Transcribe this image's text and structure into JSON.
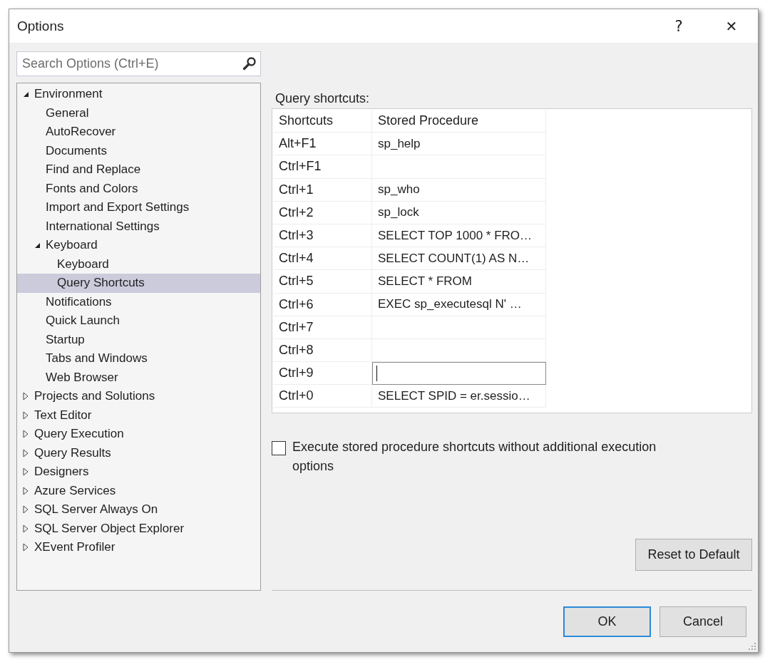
{
  "window": {
    "title": "Options",
    "help": "?",
    "close": "✕"
  },
  "search": {
    "placeholder": "Search Options (Ctrl+E)"
  },
  "tree": [
    {
      "label": "Environment",
      "expanded": true,
      "selected": false,
      "children": [
        {
          "label": "General",
          "selected": false
        },
        {
          "label": "AutoRecover",
          "selected": false
        },
        {
          "label": "Documents",
          "selected": false
        },
        {
          "label": "Find and Replace",
          "selected": false
        },
        {
          "label": "Fonts and Colors",
          "selected": false
        },
        {
          "label": "Import and Export Settings",
          "selected": false
        },
        {
          "label": "International Settings",
          "selected": false
        },
        {
          "label": "Keyboard",
          "expanded": true,
          "selected": false,
          "children": [
            {
              "label": "Keyboard",
              "selected": false
            },
            {
              "label": "Query Shortcuts",
              "selected": true
            }
          ]
        },
        {
          "label": "Notifications",
          "selected": false
        },
        {
          "label": "Quick Launch",
          "selected": false
        },
        {
          "label": "Startup",
          "selected": false
        },
        {
          "label": "Tabs and Windows",
          "selected": false
        },
        {
          "label": "Web Browser",
          "selected": false
        }
      ]
    },
    {
      "label": "Projects and Solutions",
      "expanded": false,
      "selected": false
    },
    {
      "label": "Text Editor",
      "expanded": false,
      "selected": false
    },
    {
      "label": "Query Execution",
      "expanded": false,
      "selected": false
    },
    {
      "label": "Query Results",
      "expanded": false,
      "selected": false
    },
    {
      "label": "Designers",
      "expanded": false,
      "selected": false
    },
    {
      "label": "Azure Services",
      "expanded": false,
      "selected": false
    },
    {
      "label": "SQL Server Always On",
      "expanded": false,
      "selected": false
    },
    {
      "label": "SQL Server Object Explorer",
      "expanded": false,
      "selected": false
    },
    {
      "label": "XEvent Profiler",
      "expanded": false,
      "selected": false
    }
  ],
  "shortcuts": {
    "label": "Query shortcuts:",
    "columns": [
      "Shortcuts",
      "Stored Procedure"
    ],
    "rows": [
      {
        "shortcut": "Alt+F1",
        "procedure": "sp_help",
        "editing": false
      },
      {
        "shortcut": "Ctrl+F1",
        "procedure": "",
        "editing": false
      },
      {
        "shortcut": "Ctrl+1",
        "procedure": "sp_who",
        "editing": false
      },
      {
        "shortcut": "Ctrl+2",
        "procedure": "sp_lock",
        "editing": false
      },
      {
        "shortcut": "Ctrl+3",
        "procedure": "SELECT TOP 1000 * FRO…",
        "editing": false
      },
      {
        "shortcut": "Ctrl+4",
        "procedure": "SELECT COUNT(1) AS N…",
        "editing": false
      },
      {
        "shortcut": "Ctrl+5",
        "procedure": "SELECT * FROM",
        "editing": false
      },
      {
        "shortcut": "Ctrl+6",
        "procedure": "EXEC sp_executesql N'  …",
        "editing": false
      },
      {
        "shortcut": "Ctrl+7",
        "procedure": "",
        "editing": false
      },
      {
        "shortcut": "Ctrl+8",
        "procedure": "",
        "editing": false
      },
      {
        "shortcut": "Ctrl+9",
        "procedure": "",
        "editing": true
      },
      {
        "shortcut": "Ctrl+0",
        "procedure": "SELECT SPID = er.sessio…",
        "editing": false
      }
    ]
  },
  "option": {
    "label": "Execute stored procedure shortcuts without additional execution options",
    "checked": false
  },
  "buttons": [
    {
      "label": "Reset to Default",
      "default": false
    },
    {
      "label": "OK",
      "default": true
    },
    {
      "label": "Cancel",
      "default": false
    }
  ]
}
